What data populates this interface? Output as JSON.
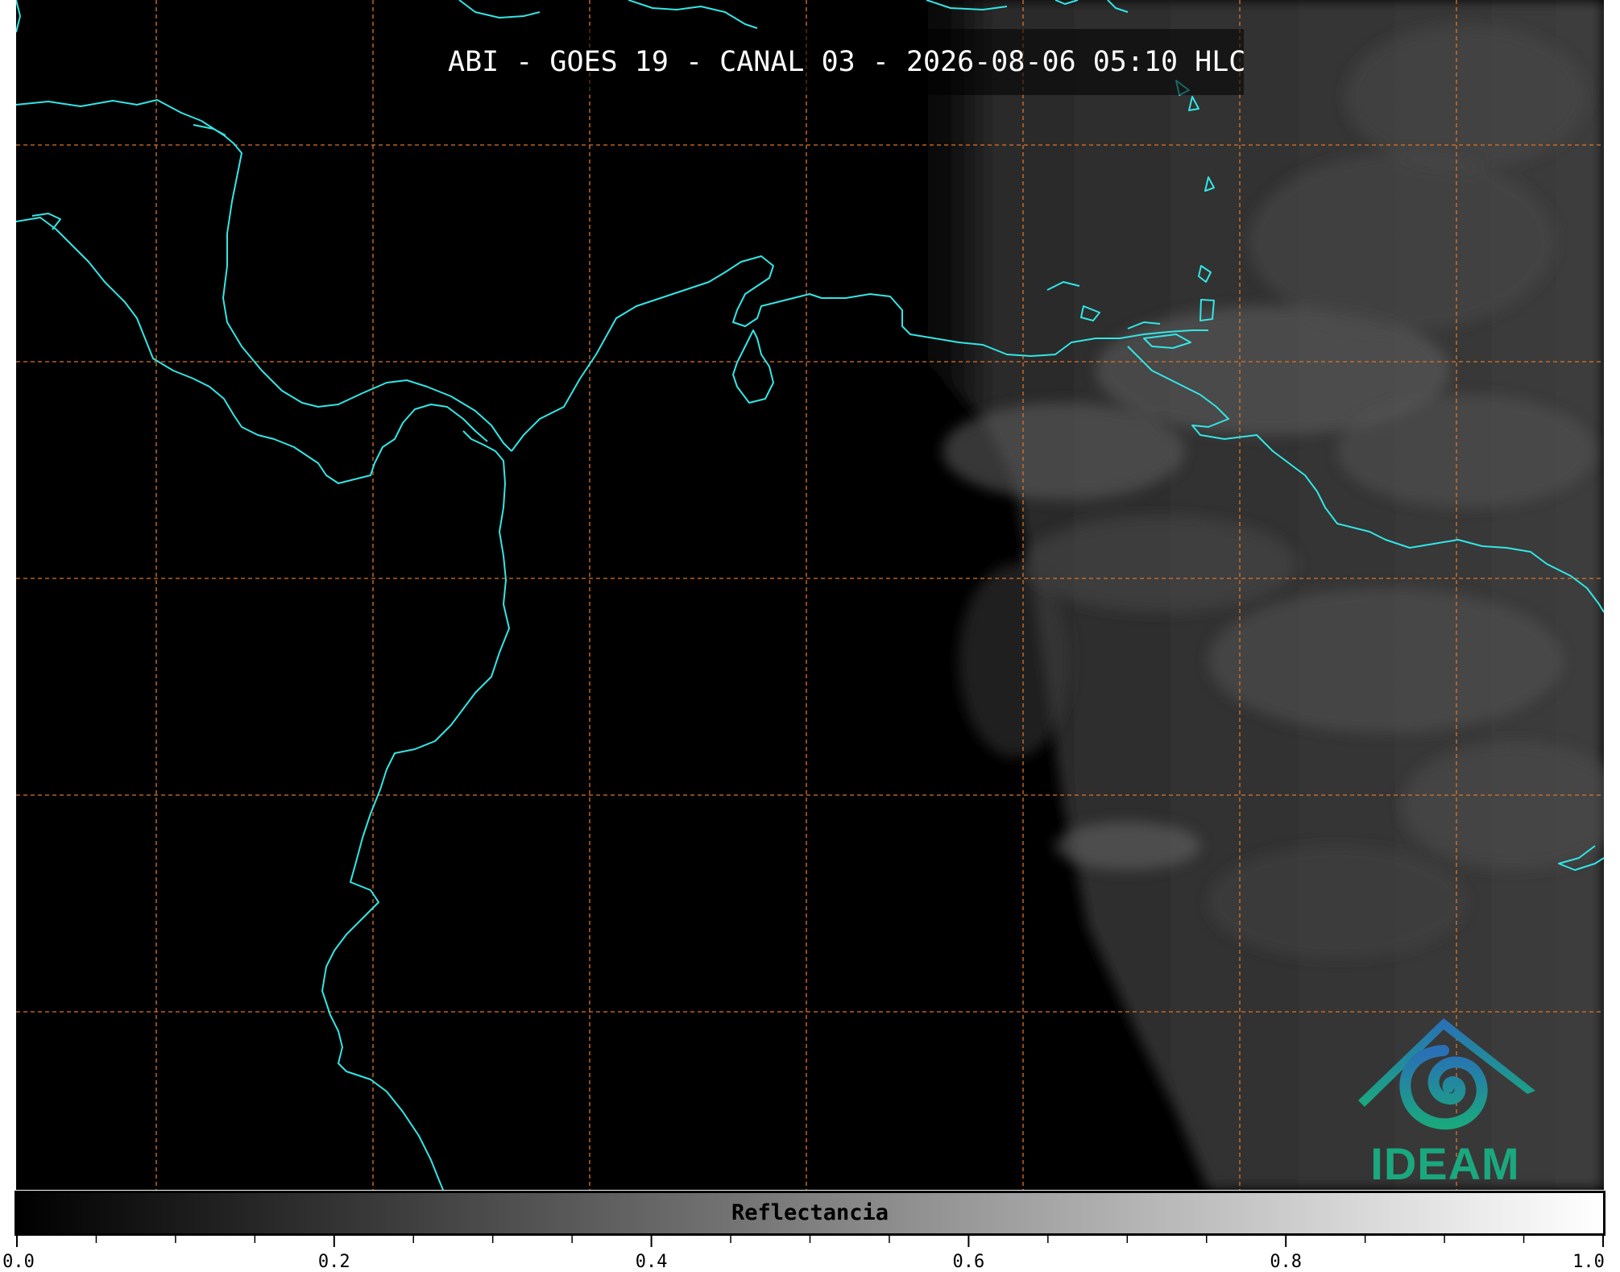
{
  "header": {
    "title": "ABI - GOES 19 - CANAL 03 - 2026-08-06 05:10 HLC"
  },
  "logo": {
    "text": "IDEAM"
  },
  "colorbar": {
    "label": "Reflectancia",
    "min": 0.0,
    "max": 1.0,
    "ticks": [
      "0.0",
      "0.2",
      "0.4",
      "0.6",
      "0.8",
      "1.0"
    ],
    "minor_step": 0.05
  },
  "colors": {
    "coastline": "#33e6e6",
    "gridline": "#d9752a",
    "background": "#000000",
    "logo_blue": "#2a6fb8",
    "logo_green": "#1aa87e"
  },
  "icons": {
    "logo": "ideam-logo-icon"
  }
}
